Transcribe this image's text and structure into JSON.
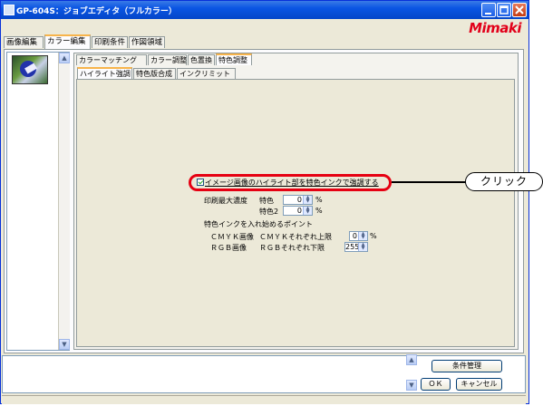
{
  "window": {
    "title": "GP-604S：ジョブエディタ（フルカラー）",
    "brand": "Mimaki"
  },
  "main_tabs": [
    "画像編集",
    "カラー編集",
    "印刷条件",
    "作図領域"
  ],
  "color_tabs": [
    "カラーマッチング",
    "カラー調整",
    "色置換",
    "特色調整"
  ],
  "spot_tabs": [
    "ハイライト強調",
    "特色版合成",
    "インクリミット"
  ],
  "options": {
    "highlight_checkbox": "イメージ画像のハイライト部を特色インクで強調する",
    "max_density_label": "印刷最大濃度",
    "spot1_label": "特色",
    "spot1_value": "0",
    "spot2_label": "特色2",
    "spot2_value": "0",
    "percent": "%",
    "start_point_label": "特色インクを入れ始めるポイント",
    "cmyk_image": "ＣＭＹＫ画像",
    "cmyk_upper": "ＣＭＹＫそれぞれ上限",
    "cmyk_value": "0",
    "rgb_image": "ＲＧＢ画像",
    "rgb_lower": "ＲＧＢそれぞれ下限",
    "rgb_value": "255"
  },
  "callout": {
    "text": "クリック"
  },
  "buttons": {
    "condition": "条件管理",
    "ok": "ＯＫ",
    "cancel": "キャンセル"
  },
  "colors": {
    "accent": "#e60012",
    "titlebar": "#0a55e3",
    "tab_highlight": "#f7b44b"
  }
}
